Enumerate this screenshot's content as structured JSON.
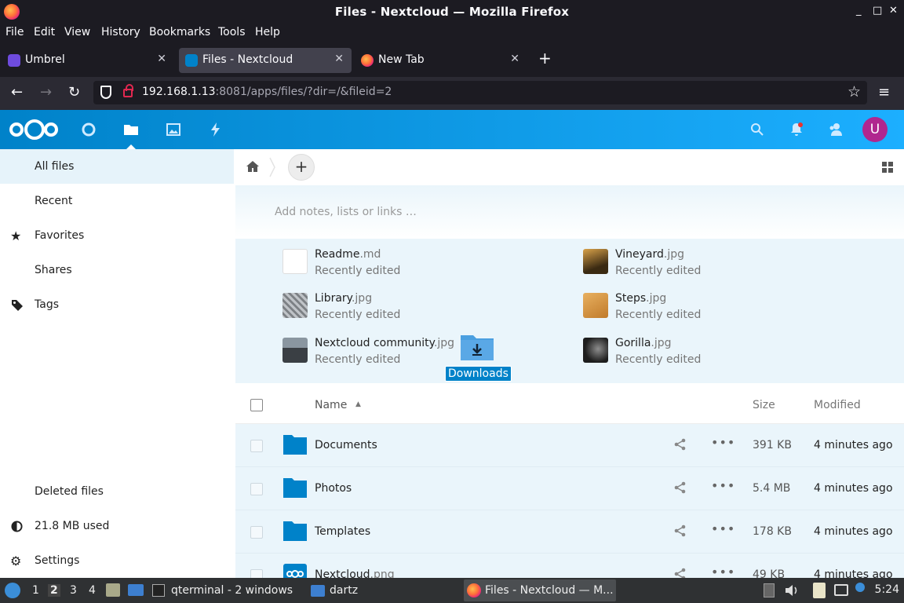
{
  "window": {
    "title": "Files - Nextcloud — Mozilla Firefox",
    "minimize": "_",
    "maximize": "□",
    "close": "✕"
  },
  "menu": [
    "File",
    "Edit",
    "View",
    "History",
    "Bookmarks",
    "Tools",
    "Help"
  ],
  "tabs": [
    {
      "label": "Umbrel",
      "close": "✕"
    },
    {
      "label": "Files - Nextcloud",
      "close": "✕"
    },
    {
      "label": "New Tab",
      "close": "✕"
    }
  ],
  "new_tab": "+",
  "nav": {
    "back": "←",
    "forward": "→",
    "reload": "↻",
    "menu": "≡",
    "bookmark": "☆"
  },
  "url": {
    "host": "192.168.1.13",
    "rest": ":8081/apps/files/?dir=/&fileid=2"
  },
  "user": {
    "avatar_letter": "U"
  },
  "sidebar": {
    "items": [
      {
        "label": "All files"
      },
      {
        "label": "Recent"
      },
      {
        "label": "Favorites",
        "icon": "★"
      },
      {
        "label": "Shares"
      },
      {
        "label": "Tags"
      }
    ],
    "bottom": {
      "deleted": "Deleted files",
      "quota": "21.8 MB used",
      "settings": "Settings"
    }
  },
  "main": {
    "add_button": "+",
    "notes_placeholder": "Add notes, lists or links …",
    "recent": [
      {
        "name": "Readme",
        "ext": ".md",
        "sub": "Recently edited",
        "thumb": "#ffffff"
      },
      {
        "name": "Vineyard",
        "ext": ".jpg",
        "sub": "Recently edited",
        "thumb": "#7a5a2a"
      },
      {
        "name": "Library",
        "ext": ".jpg",
        "sub": "Recently edited",
        "thumb": "#9aa0a6"
      },
      {
        "name": "Steps",
        "ext": ".jpg",
        "sub": "Recently edited",
        "thumb": "#d59840"
      },
      {
        "name": "Nextcloud community",
        "ext": ".jpg",
        "sub": "Recently edited",
        "thumb": "#5b6670"
      },
      {
        "name": "Gorilla",
        "ext": ".jpg",
        "sub": "Recently edited",
        "thumb": "#3a3a3a"
      }
    ],
    "dragged_folder": "Downloads",
    "columns": {
      "name": "Name",
      "sort": "▲",
      "size": "Size",
      "modified": "Modified"
    },
    "files": [
      {
        "name": "Documents",
        "ext": "",
        "size": "391 KB",
        "modified": "4 minutes ago",
        "more": "•••"
      },
      {
        "name": "Photos",
        "ext": "",
        "size": "5.4 MB",
        "modified": "4 minutes ago",
        "more": "•••"
      },
      {
        "name": "Templates",
        "ext": "",
        "size": "178 KB",
        "modified": "4 minutes ago",
        "more": "•••"
      },
      {
        "name": "Nextcloud",
        "ext": ".png",
        "size": "49 KB",
        "modified": "4 minutes ago",
        "more": "•••"
      }
    ]
  },
  "taskbar": {
    "workspaces": [
      "1",
      "2",
      "3",
      "4"
    ],
    "apps": [
      {
        "label": "qterminal - 2 windows"
      },
      {
        "label": "dartz"
      },
      {
        "label": "Files - Nextcloud — M..."
      }
    ],
    "clock": "5:24"
  },
  "colors": {
    "accent": "#0082c9",
    "folder": "#0082c9",
    "avatar": "#b0268f"
  }
}
